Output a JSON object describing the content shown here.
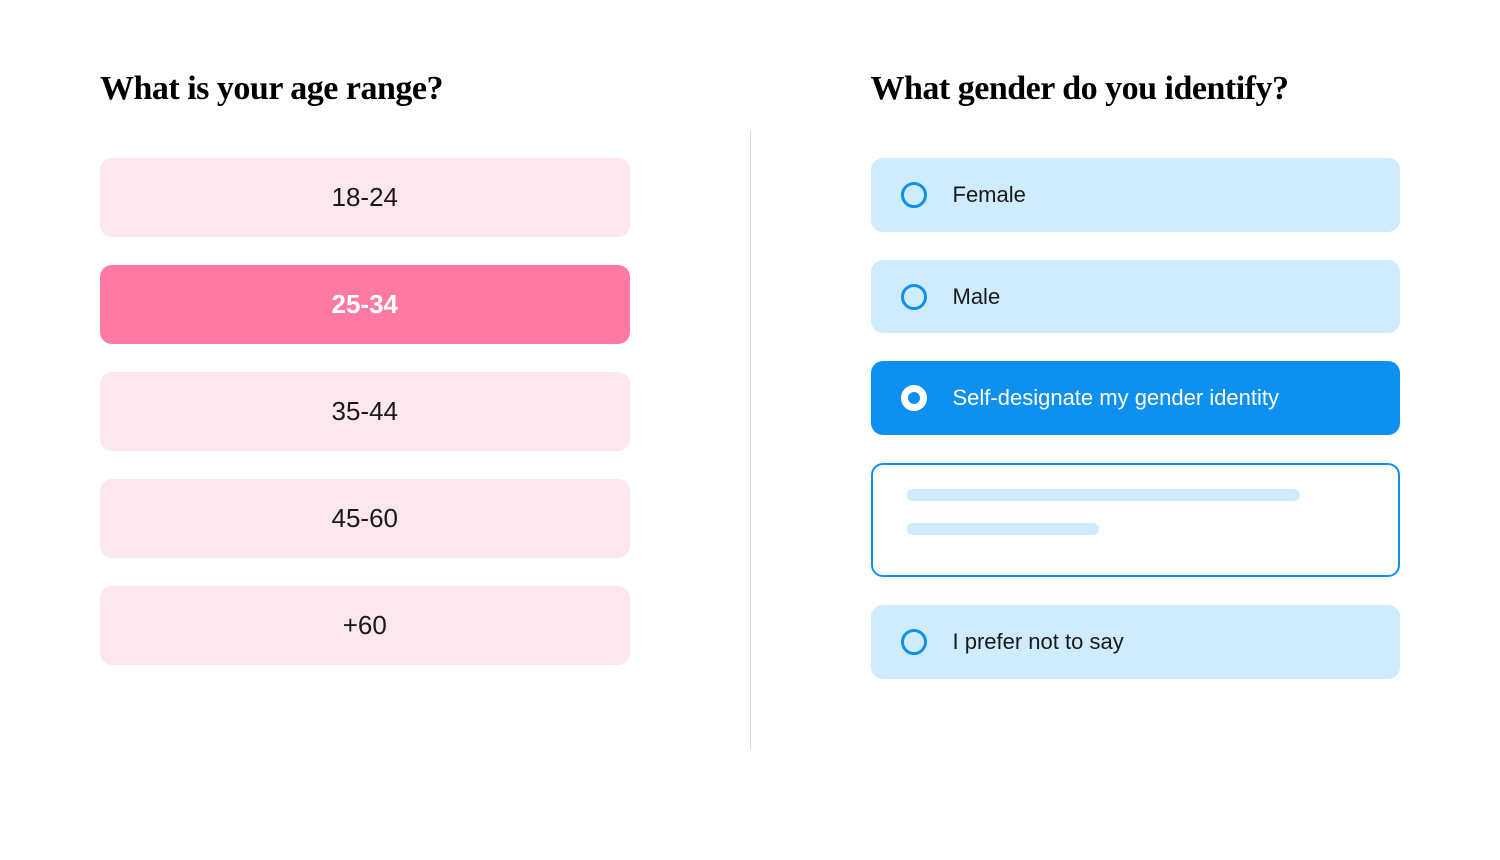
{
  "age": {
    "heading": "What is your age range?",
    "options": [
      {
        "label": "18-24",
        "selected": false
      },
      {
        "label": "25-34",
        "selected": true
      },
      {
        "label": "35-44",
        "selected": false
      },
      {
        "label": "45-60",
        "selected": false
      },
      {
        "label": "+60",
        "selected": false
      }
    ]
  },
  "gender": {
    "heading": "What gender do you identify?",
    "options": [
      {
        "label": "Female",
        "selected": false
      },
      {
        "label": "Male",
        "selected": false
      },
      {
        "label": "Self-designate my gender identity",
        "selected": true,
        "has_text_input": true
      },
      {
        "label": "I prefer not to say",
        "selected": false
      }
    ]
  },
  "colors": {
    "pink_light": "#fde7ef",
    "pink_selected": "#ff7aa2",
    "blue_light": "#ceecfb",
    "blue_selected": "#0d90ef"
  }
}
